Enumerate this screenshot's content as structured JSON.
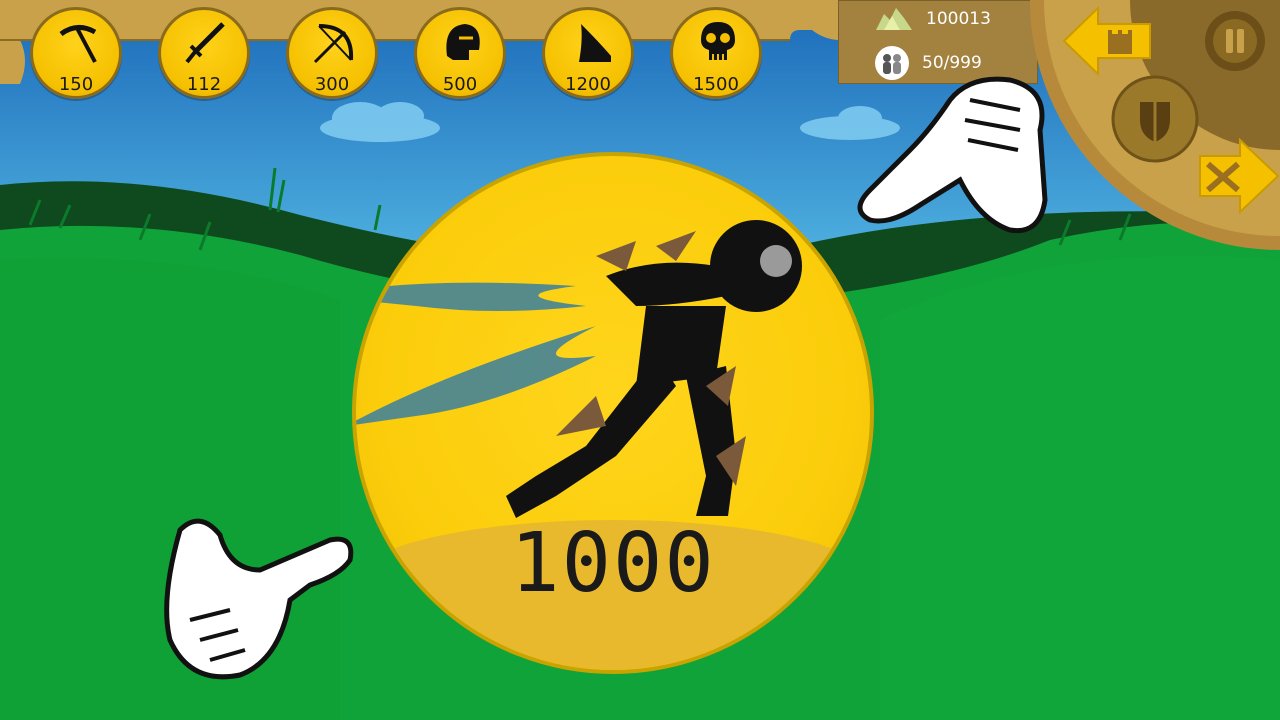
{
  "units": [
    {
      "name": "miner",
      "icon": "pickaxe-icon",
      "cost": "150"
    },
    {
      "name": "swordwrath",
      "icon": "sword-icon",
      "cost": "112"
    },
    {
      "name": "archidon",
      "icon": "bow-icon",
      "cost": "300"
    },
    {
      "name": "spearton",
      "icon": "helmet-icon",
      "cost": "500"
    },
    {
      "name": "magikill",
      "icon": "wizard-hat-icon",
      "cost": "1200"
    },
    {
      "name": "giant",
      "icon": "skull-icon",
      "cost": "1500"
    }
  ],
  "resources": {
    "gold": "100013",
    "population": "50/999"
  },
  "featured_unit": {
    "price": "1000"
  },
  "colors": {
    "sky": "#1f8fd1",
    "grass": "#10a33a",
    "coin": "#fbcd0b",
    "panel": "#c9a14a"
  }
}
